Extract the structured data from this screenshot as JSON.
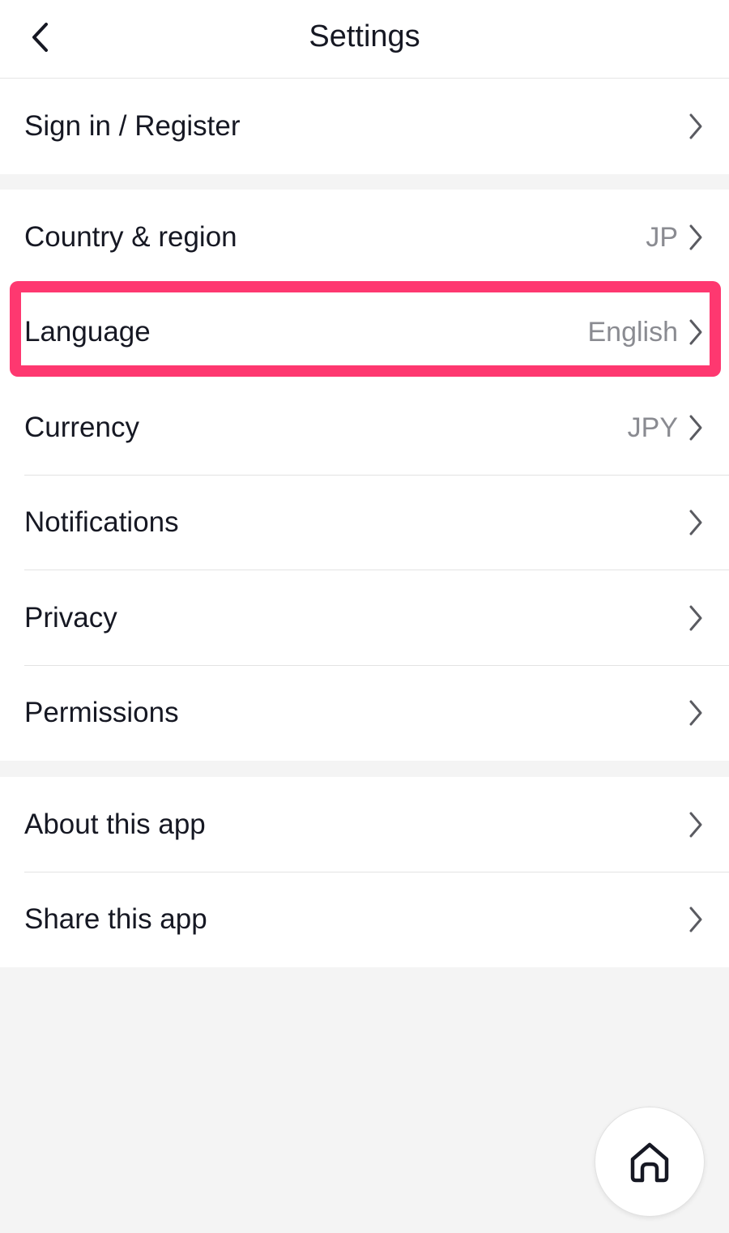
{
  "header": {
    "title": "Settings",
    "back_icon": "chevron-left-icon"
  },
  "sections": [
    {
      "rows": [
        {
          "label": "Sign in / Register",
          "value": ""
        }
      ]
    },
    {
      "rows": [
        {
          "label": "Country & region",
          "value": "JP"
        },
        {
          "label": "Language",
          "value": "English"
        },
        {
          "label": "Currency",
          "value": "JPY"
        },
        {
          "label": "Notifications",
          "value": ""
        },
        {
          "label": "Privacy",
          "value": ""
        },
        {
          "label": "Permissions",
          "value": ""
        }
      ]
    },
    {
      "rows": [
        {
          "label": "About this app",
          "value": ""
        },
        {
          "label": "Share this app",
          "value": ""
        }
      ]
    }
  ],
  "highlight": {
    "target": "Language",
    "color": "#fe3870"
  },
  "home_button": {
    "icon": "home-icon"
  },
  "colors": {
    "background": "#f4f4f4",
    "text": "#161823",
    "secondary_text": "#8a8b91",
    "accent": "#fe3870"
  }
}
